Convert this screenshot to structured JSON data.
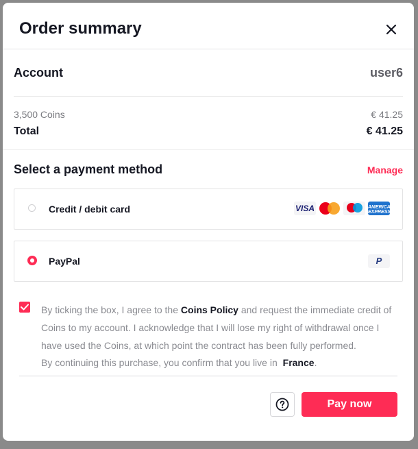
{
  "header": {
    "title": "Order summary",
    "close_icon": "close-icon"
  },
  "account": {
    "label": "Account",
    "value": "user6"
  },
  "summary": {
    "item_label": "3,500 Coins",
    "item_price": "€ 41.25",
    "total_label": "Total",
    "total_price": "€ 41.25"
  },
  "payment": {
    "title": "Select a payment method",
    "manage_label": "Manage",
    "options": [
      {
        "label": "Credit / debit card",
        "selected": false,
        "icons": [
          "visa-icon",
          "mastercard-icon",
          "maestro-icon",
          "amex-icon"
        ]
      },
      {
        "label": "PayPal",
        "selected": true,
        "icons": [
          "paypal-icon"
        ]
      }
    ],
    "visa_text": "VISA",
    "amex_text": "AMERICAN EXPRESS",
    "paypal_text": "P"
  },
  "consent": {
    "checked": true,
    "text_before": "By ticking the box, I agree to the ",
    "policy_link": "Coins Policy",
    "text_after": " and request the immediate credit of Coins to my account. I acknowledge that I will lose my right of withdrawal once I have used the Coins, at which point the contract has been fully performed.",
    "country_prefix": "By continuing this purchase, you confirm that you live in",
    "country": "France",
    "country_suffix": "."
  },
  "footer": {
    "help_icon": "question-icon",
    "pay_label": "Pay now"
  },
  "colors": {
    "accent": "#fe2c55",
    "text_primary": "#161823",
    "text_secondary": "#8a8b91"
  }
}
